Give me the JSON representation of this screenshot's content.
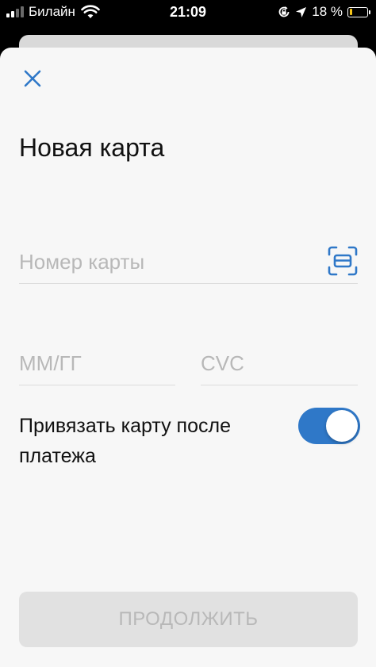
{
  "status_bar": {
    "carrier": "Билайн",
    "time": "21:09",
    "battery_percent": "18 %",
    "battery_level": 0.18,
    "battery_color": "#f5c518"
  },
  "icons": {
    "close": "close-icon",
    "scan": "card-scan-icon",
    "signal": "signal-icon",
    "wifi": "wifi-icon",
    "orientation_lock": "orientation-lock-icon",
    "location": "location-arrow-icon",
    "battery": "battery-icon"
  },
  "form": {
    "title": "Новая карта",
    "card_number_placeholder": "Номер карты",
    "expiry_placeholder": "ММ/ГГ",
    "cvc_placeholder": "CVC",
    "save_card_label": "Привязать карту после платежа",
    "save_card_enabled": true,
    "continue_label": "ПРОДОЛЖИТЬ"
  },
  "colors": {
    "accent": "#2f78c8",
    "sheet_background": "#f7f7f7",
    "placeholder": "#b8b8b8",
    "button_disabled": "#e1e1e1"
  }
}
